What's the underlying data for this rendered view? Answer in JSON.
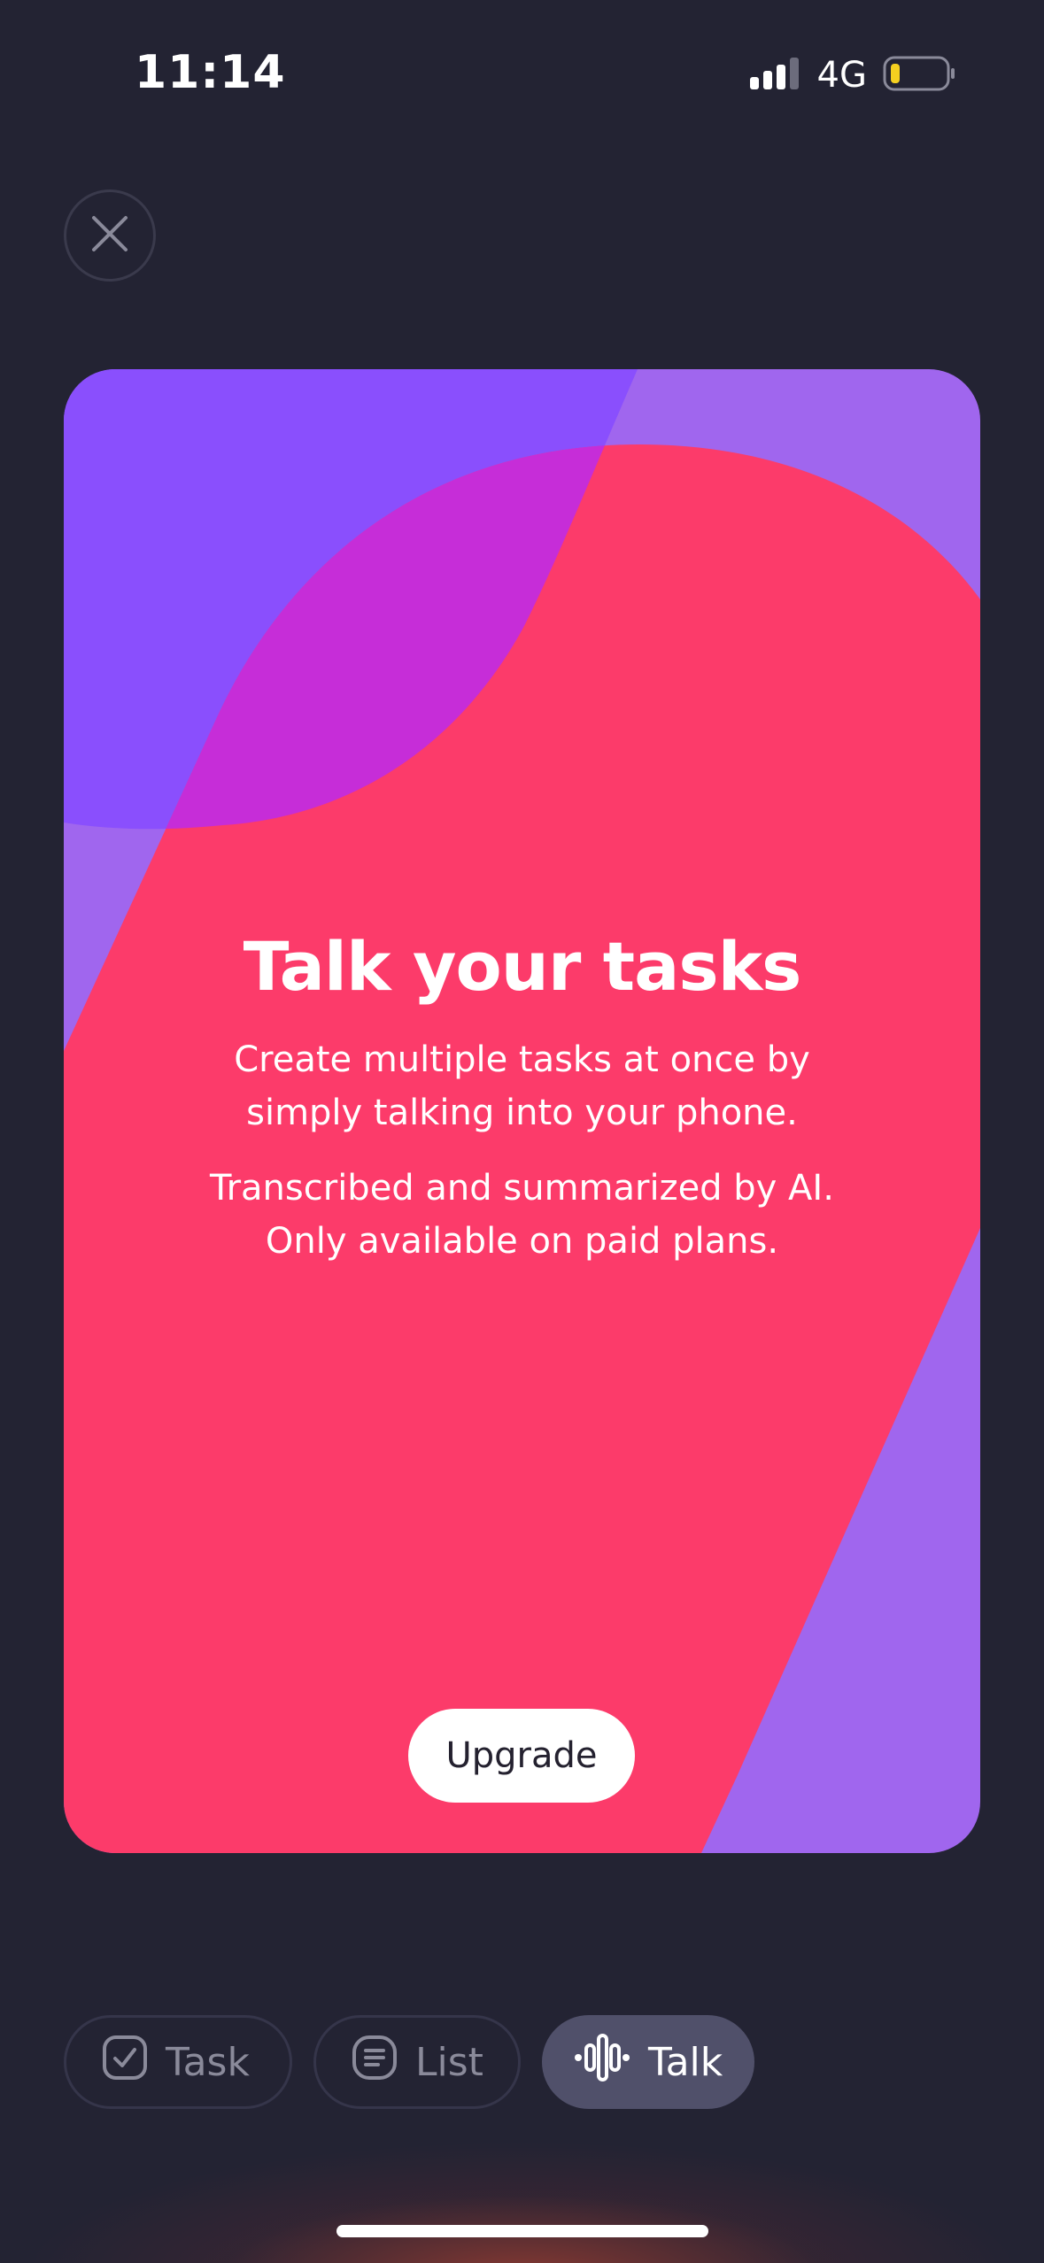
{
  "status_bar": {
    "time": "11:14",
    "network": "4G",
    "icons": [
      "signal-icon",
      "battery-low-icon"
    ]
  },
  "close_button": {
    "icon": "close-icon"
  },
  "card": {
    "title": "Talk your tasks",
    "paragraph_1": {
      "line_1": "Create multiple tasks at once by",
      "line_2": "simply talking into your phone."
    },
    "paragraph_2": {
      "line_1": "Transcribed and summarized by AI.",
      "line_2": "Only available on paid plans."
    },
    "upgrade_label": "Upgrade"
  },
  "tabs": [
    {
      "label": "Task",
      "icon": "checkbox-icon",
      "active": false
    },
    {
      "label": "List",
      "icon": "list-icon",
      "active": false
    },
    {
      "label": "Talk",
      "icon": "waveform-icon",
      "active": true
    }
  ],
  "colors": {
    "background": "#232333",
    "card_red": "#fc3b6a",
    "card_purple": "#8a4ffd",
    "card_lilac": "#a066ee",
    "card_magenta": "#c62dd8",
    "battery_yellow": "#f5d020",
    "active_tab": "#50506a"
  }
}
